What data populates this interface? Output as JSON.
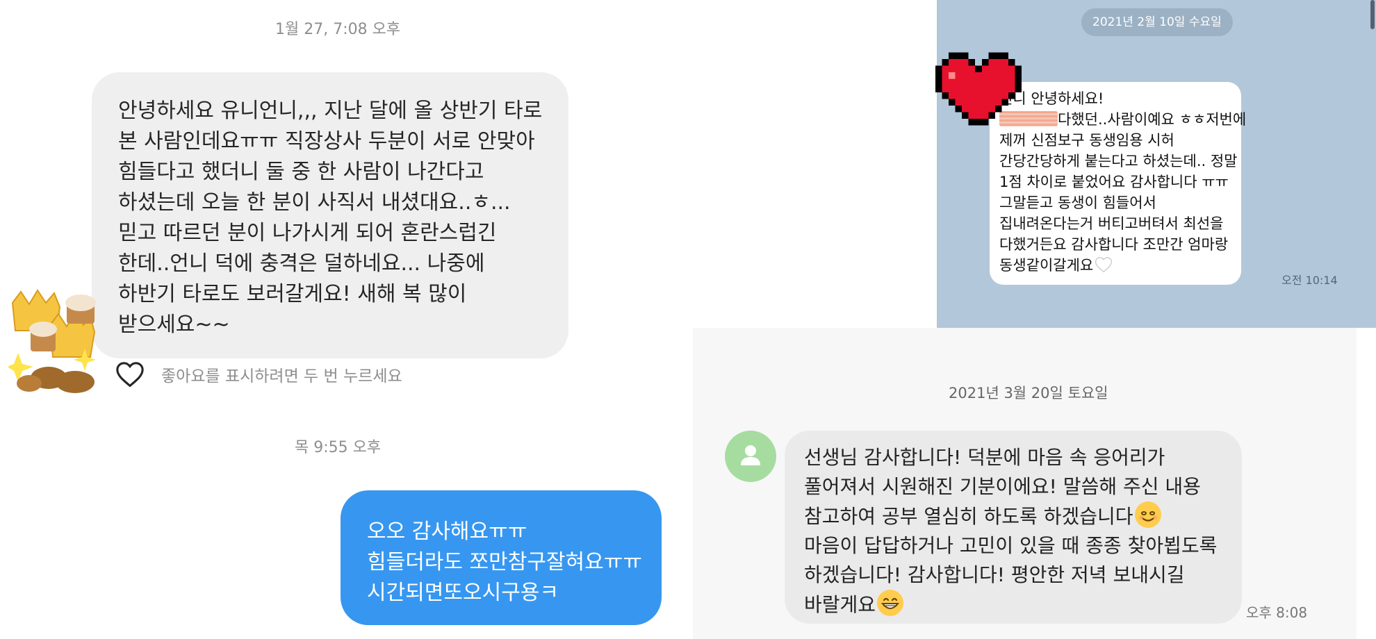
{
  "instagram": {
    "time_top": "1월 27, 7:08 오후",
    "incoming_lines": [
      "안녕하세요 유니언니,,, 지난 달에 올 상반기 타로",
      "본 사람인데요ㅠㅠ 직장상사 두분이 서로 안맞아",
      "힘들다고 했더니 둘 중 한 사람이 나간다고",
      "하셨는데 오늘 한 분이 사직서 내셨대요..ㅎ...",
      "믿고 따르던 분이 나가시게 되어 혼란스럽긴",
      "한데..언니 덕에 충격은 덜하네요... 나중에",
      "하반기 타로도 보러갈게요! 새해 복 많이",
      "받으세요~~"
    ],
    "like_hint": "좋아요를 표시하려면 두 번 누르세요",
    "time_bottom": "목 9:55 오후",
    "outgoing_lines": [
      "오오 감사해요ㅠㅠ",
      "힘들더라도 쪼만참구잘혀요ㅠㅠ",
      "시간되면또오시구용ㅋ"
    ],
    "accent_color": "#3797f0"
  },
  "kakao": {
    "date_pill": "2021년 2월 10일 수요일",
    "lines": [
      "언니 안녕하세요!",
      "다했던..사람이예요 ㅎㅎ저번에",
      "제꺼 신점보구 동생임용 시허",
      "간당간당하게 붙는다고 하셨는데.. 정말",
      "1점 차이로 붙었어요 감사합니다 ㅠㅠ",
      "그말듣고 동생이 힘들어서",
      "집내려온다는거 버티고버텨서 최선을",
      "다했거든요 감사합니다 조만간 엄마랑",
      "동생같이갈게요"
    ],
    "time": "오전 10:14",
    "background_color": "#b2c7da"
  },
  "sms": {
    "date": "2021년 3월 20일 토요일",
    "lines": [
      "선생님 감사합니다! 덕분에 마음 속 응어리가",
      "풀어져서 시원해진 기분이에요! 말씀해 주신 내용",
      "참고하여 공부 열심히 하도록 하겠습니다",
      "마음이 답답하거나 고민이 있을 때 종종 찾아뵙도록",
      "하겠습니다! 감사합니다! 평안한 저녁 보내시길",
      "바랄게요"
    ],
    "time": "오후 8:08",
    "icons": [
      "person-icon",
      "smiling-face-emoji",
      "grinning-face-emoji"
    ]
  }
}
